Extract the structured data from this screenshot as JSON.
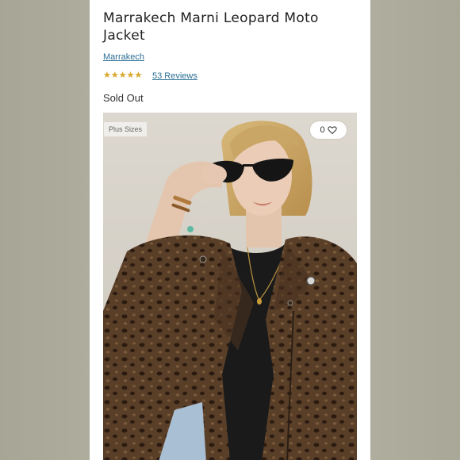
{
  "product": {
    "title": "Marrakech Marni Leopard Moto Jacket",
    "brand": "Marrakech",
    "rating": 4.5,
    "rating_max": 5,
    "reviews_label": "53 Reviews",
    "status": "Sold Out"
  },
  "image": {
    "badge": "Plus Sizes",
    "favorites_count": "0",
    "icons": {
      "favorite": "heart-outline-icon",
      "rating": "star-icon"
    }
  },
  "colors": {
    "link": "#2a6f95",
    "star": "#d8a829",
    "background": "#b5b3a3"
  }
}
